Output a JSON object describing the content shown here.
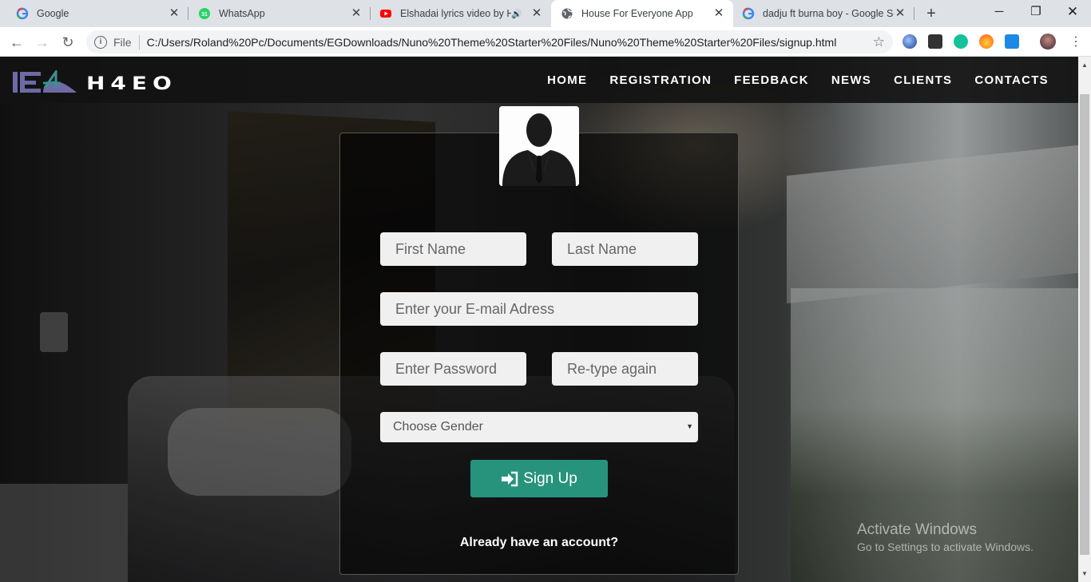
{
  "browser": {
    "tabs": [
      {
        "title": "Google",
        "icon": "google-icon"
      },
      {
        "title": "WhatsApp",
        "icon": "whatsapp-icon",
        "badge": "31"
      },
      {
        "title": "Elshadai lyrics video by H-...",
        "icon": "youtube-icon"
      },
      {
        "title": "House For Everyone App",
        "icon": "globe-icon",
        "active": true
      },
      {
        "title": "dadju ft burna boy - Google Se...",
        "icon": "google-icon"
      }
    ],
    "address": {
      "scheme": "File",
      "url": "C:/Users/Roland%20Pc/Documents/EGDownloads/Nuno%20Theme%20Starter%20Files/Nuno%20Theme%20Starter%20Files/signup.html"
    }
  },
  "site": {
    "logo_text": "H4EO",
    "nav": [
      "HOME",
      "REGISTRATION",
      "FEEDBACK",
      "NEWS",
      "CLIENTS",
      "CONTACTS"
    ]
  },
  "form": {
    "first_name_placeholder": "First Name",
    "last_name_placeholder": "Last Name",
    "email_placeholder": "Enter your E-mail Adress",
    "password_placeholder": "Enter Password",
    "retype_placeholder": "Re-type again",
    "gender_selected": "Choose Gender",
    "submit_label": "Sign Up",
    "already_account": "Already have an account?"
  },
  "watermark": {
    "line1": "Activate Windows",
    "line2": "Go to Settings to activate Windows."
  },
  "colors": {
    "accent": "#28937c",
    "nav_bg": "#121212"
  }
}
